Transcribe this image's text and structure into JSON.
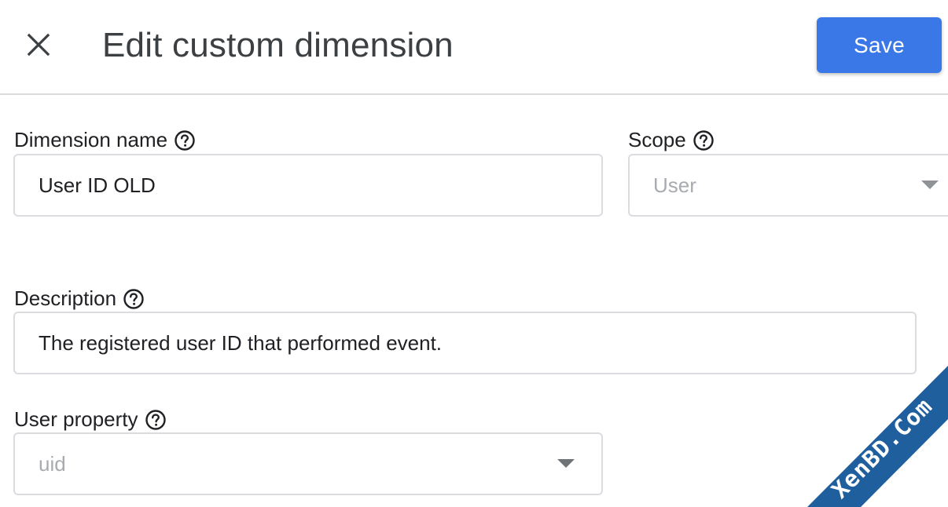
{
  "header": {
    "title": "Edit custom dimension",
    "save_label": "Save"
  },
  "form": {
    "dimension_name": {
      "label": "Dimension name",
      "value": "User ID OLD"
    },
    "scope": {
      "label": "Scope",
      "value": "User"
    },
    "description": {
      "label": "Description",
      "value": "The registered user ID that performed event."
    },
    "user_property": {
      "label": "User property",
      "value": "uid"
    }
  },
  "watermark": {
    "text": "XenBD.Com"
  },
  "colors": {
    "primary_button": "#3b78e7",
    "border": "#dadce0",
    "disabled_text": "#a8abaf",
    "watermark": "#1f5f9e"
  },
  "icons": {
    "close": "close-icon",
    "help": "help-circle-icon",
    "dropdown": "dropdown-arrow-icon"
  }
}
